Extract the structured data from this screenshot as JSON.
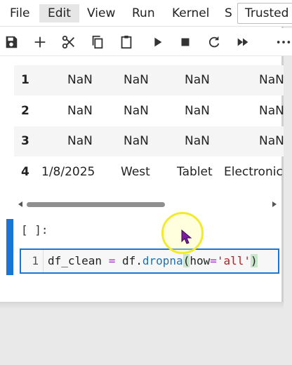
{
  "menu": {
    "items": [
      "File",
      "Edit",
      "View",
      "Run",
      "Kernel",
      "S"
    ],
    "trusted_label": "Trusted"
  },
  "toolbar": {
    "buttons": [
      "save-icon",
      "add-icon",
      "cut-icon",
      "copy-icon",
      "paste-icon",
      "run-icon",
      "stop-icon",
      "restart-icon",
      "fast-forward-icon",
      "more-icon"
    ]
  },
  "output": {
    "rows": [
      {
        "index": "1",
        "cells": [
          "NaN",
          "NaN",
          "NaN",
          "NaN"
        ]
      },
      {
        "index": "2",
        "cells": [
          "NaN",
          "NaN",
          "NaN",
          "NaN"
        ]
      },
      {
        "index": "3",
        "cells": [
          "NaN",
          "NaN",
          "NaN",
          "NaN"
        ]
      },
      {
        "index": "4",
        "cells": [
          "1/8/2025",
          "West",
          "Tablet",
          "Electronic"
        ]
      }
    ]
  },
  "code_cell": {
    "prompt": "[ ]:",
    "line_number": "1",
    "code": {
      "var": "df_clean",
      "op": "=",
      "obj": "df.",
      "method": "dropna",
      "paren_open": "(",
      "arg": "how",
      "eq": "=",
      "str": "'all'",
      "paren_close": ")"
    }
  },
  "colors": {
    "accent": "#1976d2",
    "cursor_ring": "#f2ea2a",
    "pointer": "#7b1fa2"
  }
}
